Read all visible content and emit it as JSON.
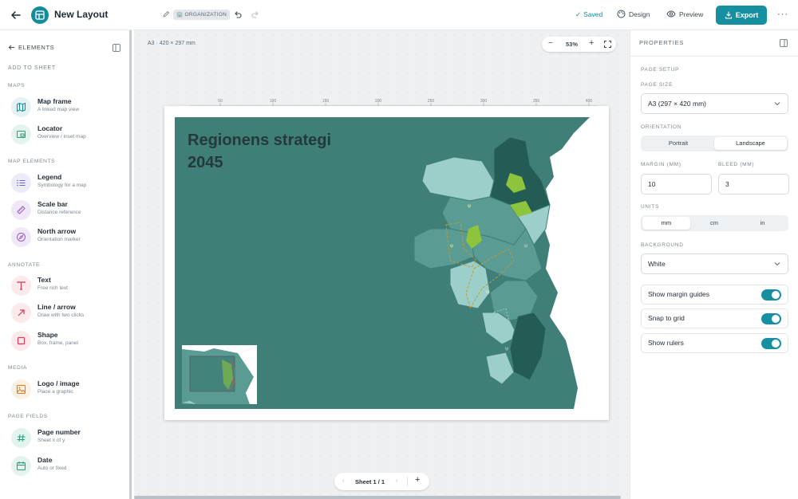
{
  "topbar": {
    "title": "New Layout",
    "badge": "ORGANIZATION",
    "status": "Saved",
    "design": "Design",
    "preview": "Preview",
    "export": "Export",
    "more": "···",
    "accent": "#1690a0"
  },
  "sidebar": {
    "header": "ELEMENTS",
    "add_to_sheet": "ADD TO SHEET",
    "sections": {
      "maps": "MAPS",
      "map_elements": "MAP ELEMENTS",
      "annotate": "ANNOTATE",
      "media": "MEDIA",
      "page_fields": "PAGE FIELDS"
    },
    "items": [
      {
        "title": "Map frame",
        "sub": "A linked map view",
        "icon": "map-icon"
      },
      {
        "title": "Locator",
        "sub": "Overview / inset map",
        "icon": "locator-icon"
      },
      {
        "title": "Legend",
        "sub": "Symbology for a map",
        "icon": "list-icon"
      },
      {
        "title": "Scale bar",
        "sub": "Distance reference",
        "icon": "ruler-icon"
      },
      {
        "title": "North arrow",
        "sub": "Orientation marker",
        "icon": "compass-icon"
      },
      {
        "title": "Text",
        "sub": "Free rich text",
        "icon": "text-icon"
      },
      {
        "title": "Line / arrow",
        "sub": "Draw with two clicks",
        "icon": "arrow-icon"
      },
      {
        "title": "Shape",
        "sub": "Box, frame, panel",
        "icon": "square-icon"
      },
      {
        "title": "Logo / image",
        "sub": "Place a graphic",
        "icon": "image-icon"
      },
      {
        "title": "Page number",
        "sub": "Sheet x of y",
        "icon": "hash-icon"
      },
      {
        "title": "Date",
        "sub": "Auto or fixed",
        "icon": "calendar-icon"
      }
    ]
  },
  "canvas": {
    "page_label": "A3 · 420 × 297 mm",
    "zoom": "53%",
    "zoom_minus": "−",
    "zoom_plus": "+",
    "map_title": "Regionens strategi 2045",
    "sheet_label": "Sheet 1 / 1",
    "sheet_prev": "‹",
    "sheet_next": "›",
    "sheet_add": "+",
    "ruler_ticks": [
      "50",
      "100",
      "150",
      "200",
      "250",
      "300",
      "350",
      "400"
    ],
    "map_colors": {
      "water": "#3f7f78",
      "land": "#5a9b94",
      "light": "#9ccfca",
      "dark": "#225c54",
      "green": "#8cc43c"
    }
  },
  "properties": {
    "title": "PROPERTIES",
    "page_setup": "PAGE SETUP",
    "page_size_label": "PAGE SIZE",
    "page_size": "A3 (297 × 420 mm)",
    "orientation_label": "ORIENTATION",
    "orientation": [
      "Portrait",
      "Landscape"
    ],
    "orientation_selected": "Landscape",
    "margin_label": "MARGIN (MM)",
    "margin": "10",
    "bleed_label": "BLEED (MM)",
    "bleed": "3",
    "units_label": "UNITS",
    "units": [
      "mm",
      "cm",
      "in"
    ],
    "units_selected": "mm",
    "background_label": "BACKGROUND",
    "background": "White",
    "toggles": [
      {
        "label": "Show margin guides",
        "on": true
      },
      {
        "label": "Snap to grid",
        "on": true
      },
      {
        "label": "Show rulers",
        "on": true
      }
    ]
  }
}
